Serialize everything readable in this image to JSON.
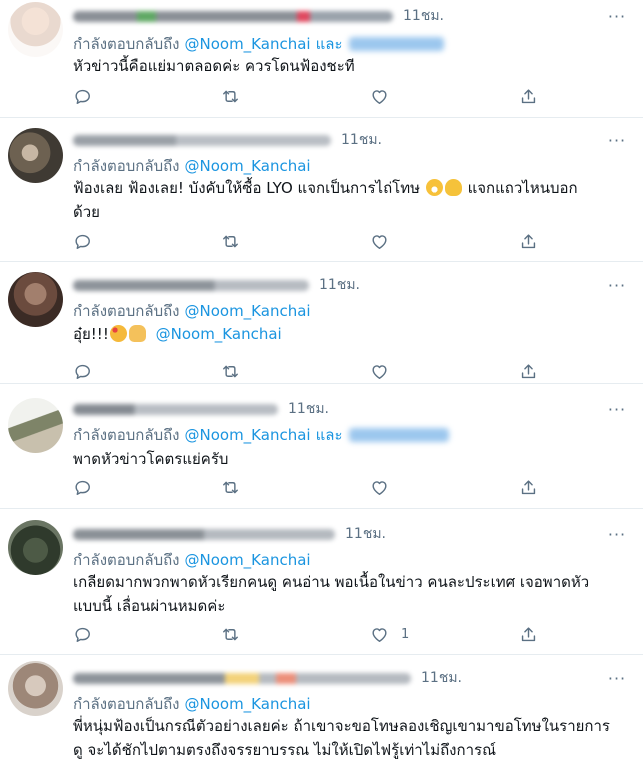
{
  "reply_prefix": "กำลังตอบกลับถึง",
  "and_word": "และ",
  "icons": [
    "reply-icon",
    "retweet-icon",
    "like-icon",
    "share-icon",
    "more-icon"
  ],
  "tweets": [
    {
      "time": "11ชม.",
      "mention": "@Noom_Kanchai",
      "has_second_mention": true,
      "text": "หัวข่าวนี้คือแย่มาตลอดค่ะ ควรโดนฟ้องชะที",
      "like_count": ""
    },
    {
      "time": "11ชม.",
      "mention": "@Noom_Kanchai",
      "has_second_mention": false,
      "text_line1": "ฟ้องเลย ฟ้องเลย!  บังคับให้ซื้อ LYO แจกเป็นการไถ่โทษ",
      "text_line1b": "แจกแถวไหนบอก",
      "text_line2": "ด้วย",
      "like_count": ""
    },
    {
      "time": "11ชม.",
      "mention": "@Noom_Kanchai",
      "has_second_mention": false,
      "text": "อุ๋ย!!!",
      "text_mention": "@Noom_Kanchai",
      "like_count": ""
    },
    {
      "time": "11ชม.",
      "mention": "@Noom_Kanchai",
      "has_second_mention": true,
      "text": "พาดหัวข่าวโคตรแย่ครับ",
      "like_count": ""
    },
    {
      "time": "11ชม.",
      "mention": "@Noom_Kanchai",
      "has_second_mention": false,
      "text_line1": "เกลียดมากพวกพาดหัวเรียกคนดู คนอ่าน พอเนื้อในข่าว คนละประเทศ เจอพาดหัว",
      "text_line2": "แบบนี้ เลื่อนผ่านหมดค่ะ",
      "like_count": "1"
    },
    {
      "time": "11ชม.",
      "mention": "@Noom_Kanchai",
      "has_second_mention": false,
      "text_line1": "พี่หนุ่มฟ้องเป็นกรณีตัวอย่างเลยค่ะ ถ้าเขาจะขอโทษลองเชิญเขามาขอโทษในรายการ",
      "text_line2": "ดู จะได้ชักไปตามตรงถึงจรรยาบรรณ ไม่ให้เปิดไฟรู้เท่าไม่ถึงการณ์",
      "like_count": ""
    }
  ]
}
